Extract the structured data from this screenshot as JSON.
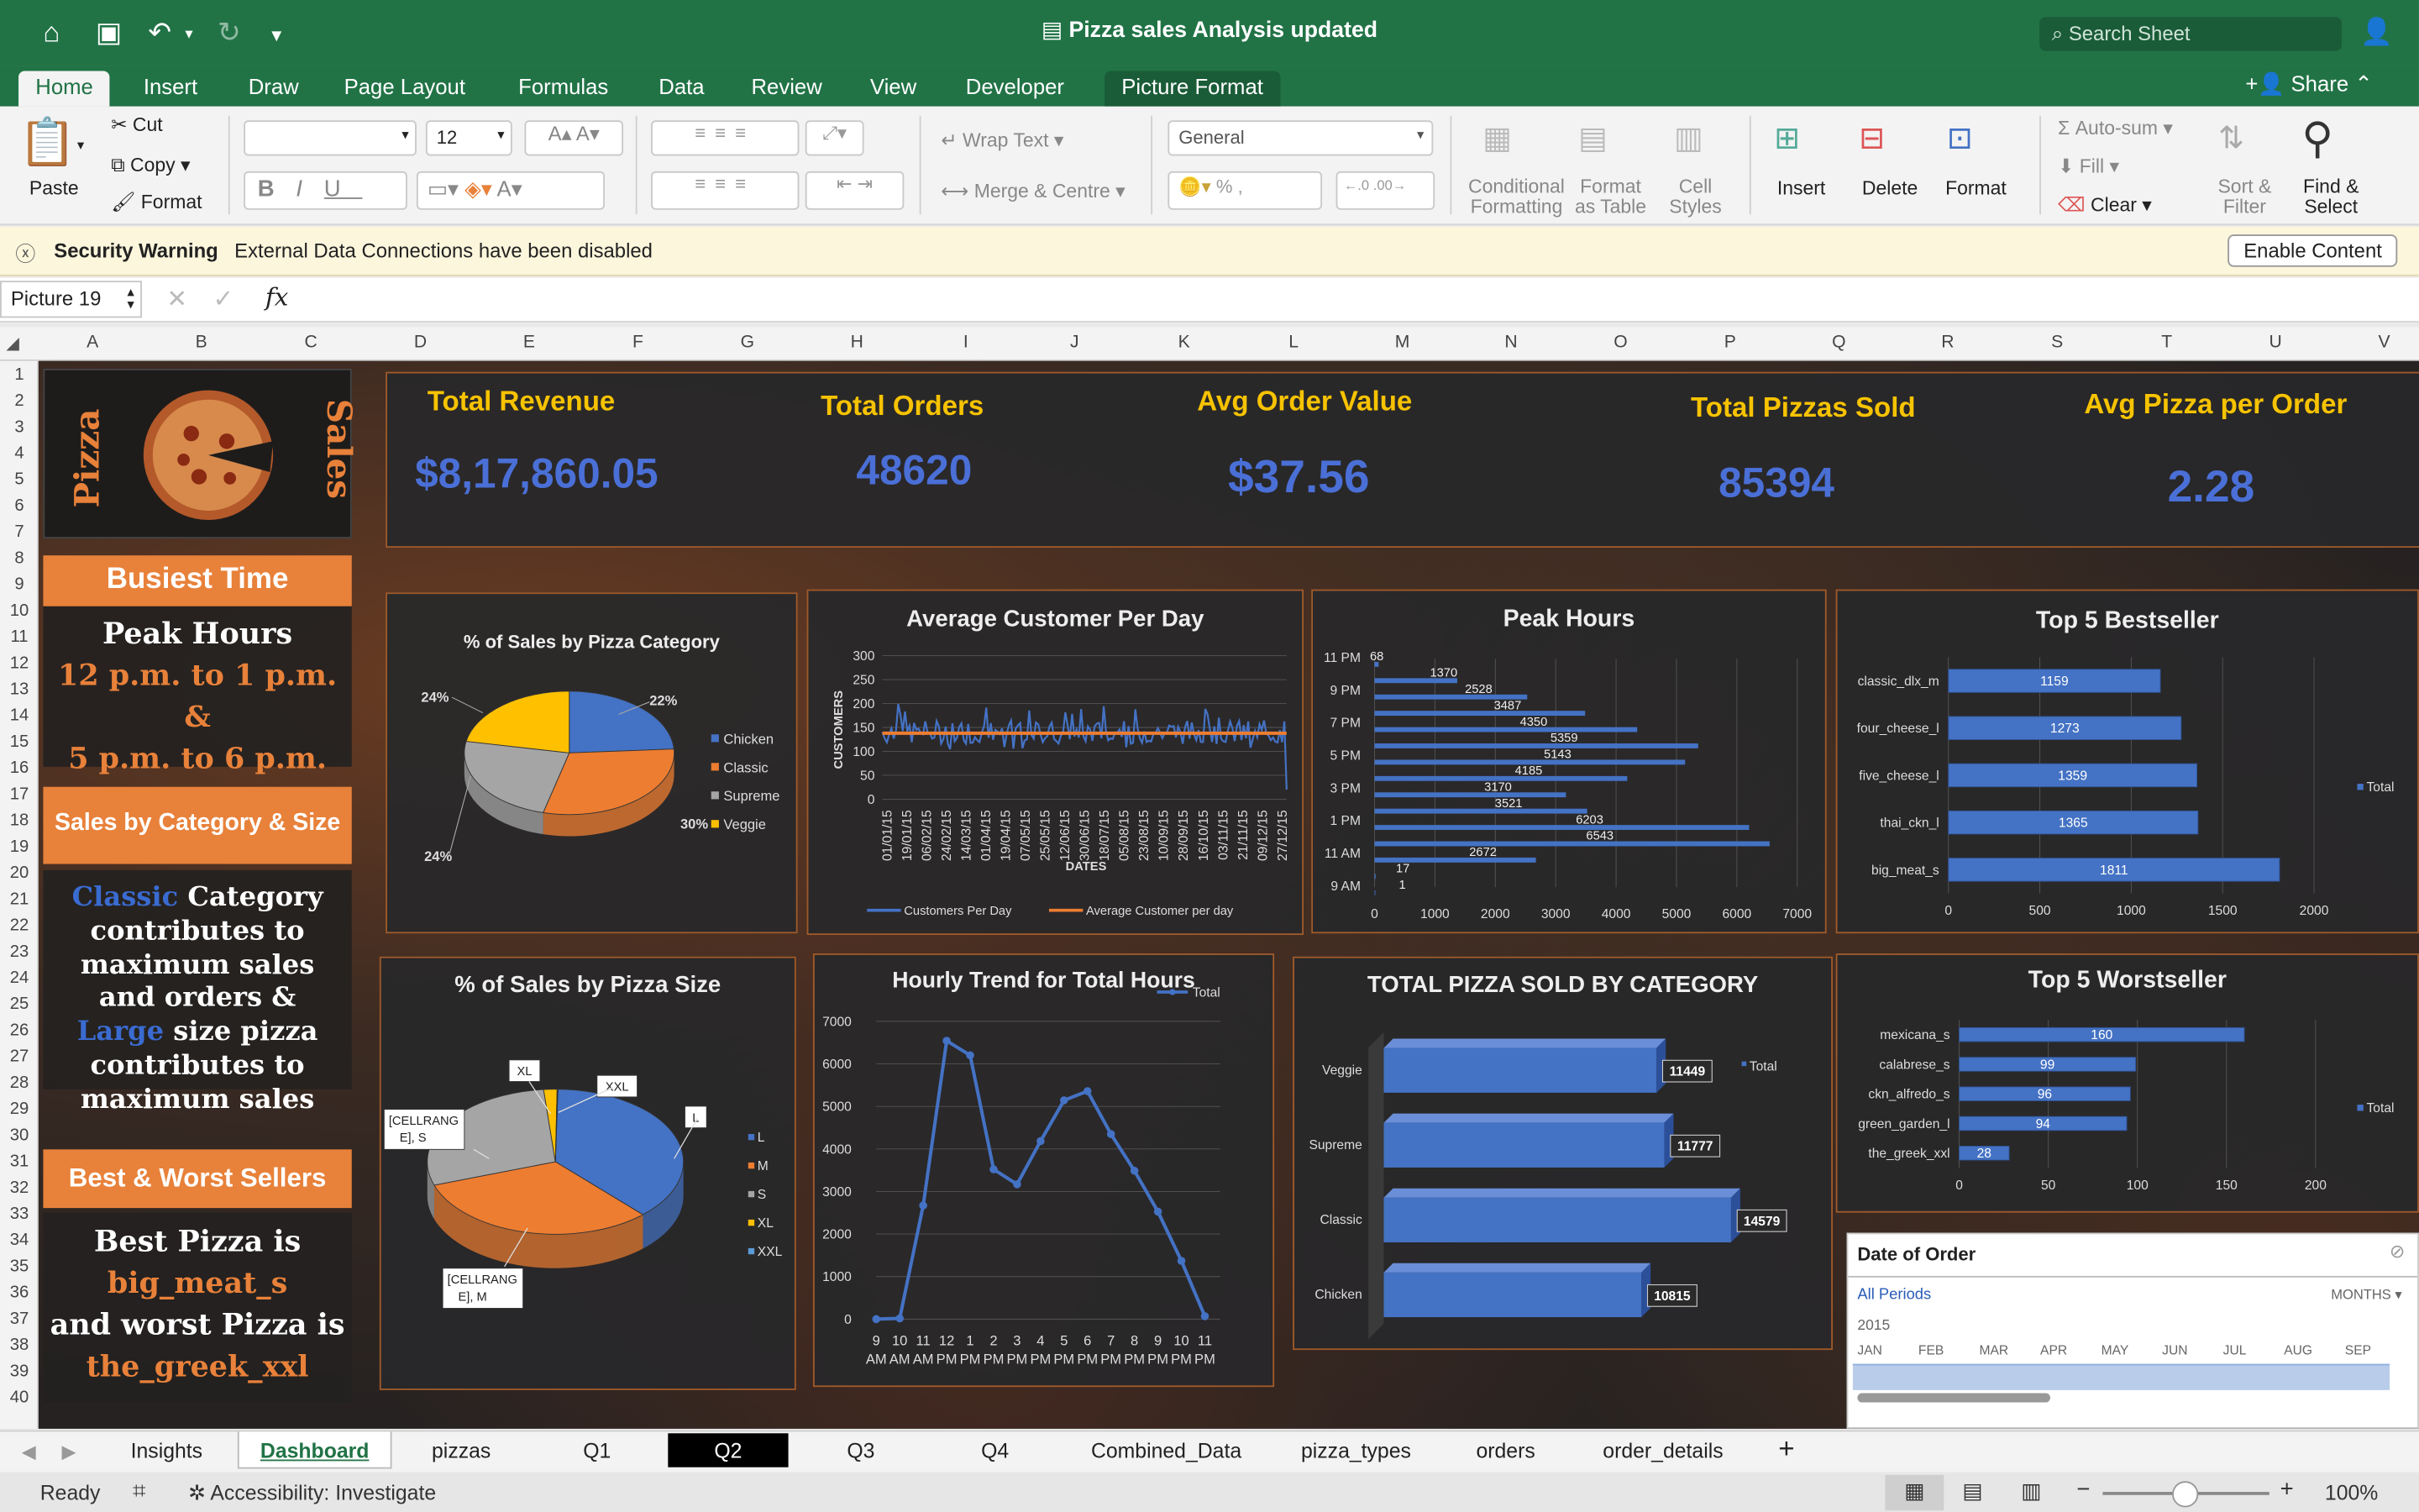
{
  "window": {
    "title": "Pizza sales Analysis updated",
    "search_placeholder": "Search Sheet"
  },
  "ribbon_tabs": [
    "Home",
    "Insert",
    "Draw",
    "Page Layout",
    "Formulas",
    "Data",
    "Review",
    "View",
    "Developer",
    "Picture Format"
  ],
  "share_label": "Share",
  "ribbon": {
    "paste": "Paste",
    "cut": "Cut",
    "copy": "Copy",
    "format_painter": "Format",
    "font_name": "",
    "font_size": "12",
    "wrap_text": "Wrap Text",
    "merge_centre": "Merge & Centre",
    "number_format": "General",
    "conditional_formatting": "Conditional Formatting",
    "format_as_table": "Format as Table",
    "cell_styles": "Cell Styles",
    "insert": "Insert",
    "delete": "Delete",
    "format": "Format",
    "autosum": "Auto-sum",
    "fill": "Fill",
    "clear": "Clear",
    "sort_filter": "Sort & Filter",
    "find_select": "Find & Select"
  },
  "security": {
    "title": "Security Warning",
    "message": "External Data Connections have been disabled",
    "button": "Enable Content"
  },
  "formula_bar": {
    "name_box": "Picture 19",
    "formula": ""
  },
  "columns": [
    "A",
    "B",
    "C",
    "D",
    "E",
    "F",
    "G",
    "H",
    "I",
    "J",
    "K",
    "L",
    "M",
    "N",
    "O",
    "P",
    "Q",
    "R",
    "S",
    "T",
    "U",
    "V"
  ],
  "rows": [
    "1",
    "2",
    "3",
    "4",
    "5",
    "6",
    "7",
    "8",
    "9",
    "10",
    "11",
    "12",
    "13",
    "14",
    "15",
    "16",
    "17",
    "18",
    "19",
    "20",
    "21",
    "22",
    "23",
    "24",
    "25",
    "26",
    "27",
    "28",
    "29",
    "30",
    "31",
    "32",
    "33",
    "34",
    "35",
    "36",
    "37",
    "38",
    "39",
    "40"
  ],
  "logo": {
    "left": "Pizza",
    "right": "Sales"
  },
  "kpis": [
    {
      "label": "Total Revenue",
      "value": "$8,17,860.05"
    },
    {
      "label": "Total Orders",
      "value": "48620"
    },
    {
      "label": "Avg Order Value",
      "value": "$37.56"
    },
    {
      "label": "Total Pizzas Sold",
      "value": "85394"
    },
    {
      "label": "Avg Pizza per Order",
      "value": "2.28"
    }
  ],
  "sidebar": {
    "busiest_title": "Busiest Time",
    "peak_label": "Peak Hours",
    "peak_line1": "12 p.m. to 1 p.m. &",
    "peak_line2": "5 p.m. to 6 p.m.",
    "catsize_title": "Sales by Category & Size",
    "catsize_text": "Classic Category contributes to maximum sales and orders & Large size pizza contributes to maximum sales",
    "bestworst_title": "Best & Worst Sellers",
    "best_label": "Best Pizza is",
    "best_name": "big_meat_s",
    "worst_label": "and worst Pizza is",
    "worst_name": "the_greek_xxl"
  },
  "chart_data": [
    {
      "id": "category-pie",
      "type": "pie",
      "title": "% of Sales by Pizza Category",
      "categories": [
        "Chicken",
        "Classic",
        "Supreme",
        "Veggie"
      ],
      "values": [
        24,
        30,
        24,
        22
      ],
      "labels": [
        "24%",
        "30%",
        "24%",
        "22%"
      ],
      "colors": [
        "#4472c4",
        "#ed7d31",
        "#a5a5a5",
        "#ffc000"
      ],
      "legend": "right"
    },
    {
      "id": "customers-line",
      "type": "line",
      "title": "Average Customer Per Day",
      "xlabel": "DATES",
      "ylabel": "CUSTOMERS",
      "yticks": [
        0,
        50,
        100,
        150,
        200,
        250,
        300
      ],
      "ylim": [
        0,
        300
      ],
      "xticks": [
        "01/01/15",
        "19/01/15",
        "06/02/15",
        "24/02/15",
        "14/03/15",
        "01/04/15",
        "19/04/15",
        "07/05/15",
        "25/05/15",
        "12/06/15",
        "30/06/15",
        "18/07/15",
        "05/08/15",
        "23/08/15",
        "10/09/15",
        "28/09/15",
        "16/10/15",
        "03/11/15",
        "21/11/15",
        "09/12/15",
        "27/12/15"
      ],
      "series": [
        {
          "name": "Customers Per Day",
          "color": "#4472c4",
          "approx_range": [
            95,
            200
          ]
        },
        {
          "name": "Average Customer per day",
          "color": "#ed7d31",
          "value": 138
        }
      ],
      "legend": "bottom"
    },
    {
      "id": "peak-hours",
      "type": "bar",
      "title": "Peak Hours",
      "categories": [
        "11 PM",
        "10 PM",
        "9 PM",
        "8 PM",
        "7 PM",
        "6 PM",
        "5 PM",
        "4 PM",
        "3 PM",
        "2 PM",
        "1 PM",
        "12 PM",
        "11 AM",
        "10 AM",
        "9 AM"
      ],
      "values": [
        68,
        1370,
        2528,
        3487,
        4350,
        5359,
        5143,
        4185,
        3170,
        3521,
        6203,
        6543,
        2672,
        17,
        1
      ],
      "xticks": [
        0,
        1000,
        2000,
        3000,
        4000,
        5000,
        6000,
        7000
      ],
      "xlim": [
        0,
        7000
      ],
      "ytick_labels": [
        "11 PM",
        "9 PM",
        "7 PM",
        "5 PM",
        "3 PM",
        "1 PM",
        "11 AM",
        "9 AM"
      ]
    },
    {
      "id": "top5-best",
      "type": "bar",
      "title": "Top 5 Bestseller",
      "categories": [
        "classic_dlx_m",
        "four_cheese_l",
        "five_cheese_l",
        "thai_ckn_l",
        "big_meat_s"
      ],
      "values": [
        1159,
        1273,
        1359,
        1365,
        1811
      ],
      "xticks": [
        0,
        500,
        1000,
        1500,
        2000
      ],
      "xlim": [
        0,
        2000
      ],
      "legend": "Total"
    },
    {
      "id": "size-pie",
      "type": "pie",
      "title": "% of Sales by Pizza Size",
      "categories": [
        "L",
        "M",
        "S",
        "XL",
        "XXL"
      ],
      "values": [
        38,
        32,
        29,
        1.7,
        0.1
      ],
      "labels": [
        "L",
        "[CELLRANG E], M",
        "[CELLRANG E], S",
        "XL",
        "XXL"
      ],
      "colors": [
        "#4472c4",
        "#ed7d31",
        "#a5a5a5",
        "#ffc000",
        "#5b9bd5"
      ],
      "legend": "right"
    },
    {
      "id": "hourly-trend",
      "type": "line",
      "title": "Hourly Trend for Total Hours",
      "legend": "Total",
      "categories": [
        "9 AM",
        "10 AM",
        "11 AM",
        "12 PM",
        "1 PM",
        "2 PM",
        "3 PM",
        "4 PM",
        "5 PM",
        "6 PM",
        "7 PM",
        "8 PM",
        "9 PM",
        "10 PM",
        "11 PM"
      ],
      "tick_hours": [
        "9",
        "10",
        "11",
        "12",
        "1",
        "2",
        "3",
        "4",
        "5",
        "6",
        "7",
        "8",
        "9",
        "10",
        "11"
      ],
      "tick_ampm": [
        "AM",
        "AM",
        "AM",
        "PM",
        "PM",
        "PM",
        "PM",
        "PM",
        "PM",
        "PM",
        "PM",
        "PM",
        "PM",
        "PM",
        "PM"
      ],
      "values": [
        1,
        17,
        2672,
        6543,
        6203,
        3521,
        3170,
        4185,
        5143,
        5359,
        4350,
        3487,
        2528,
        1370,
        68
      ],
      "yticks": [
        0,
        1000,
        2000,
        3000,
        4000,
        5000,
        6000,
        7000
      ],
      "ylim": [
        0,
        7000
      ]
    },
    {
      "id": "sold-by-category",
      "type": "bar",
      "title": "TOTAL PIZZA SOLD BY CATEGORY",
      "legend": "Total",
      "categories": [
        "Veggie",
        "Supreme",
        "Classic",
        "Chicken"
      ],
      "values": [
        11449,
        11777,
        14579,
        10815
      ]
    },
    {
      "id": "top5-worst",
      "type": "bar",
      "title": "Top 5 Worstseller",
      "categories": [
        "mexicana_s",
        "calabrese_s",
        "ckn_alfredo_s",
        "green_garden_l",
        "the_greek_xxl"
      ],
      "values": [
        160,
        99,
        96,
        94,
        28
      ],
      "xticks": [
        0,
        50,
        100,
        150,
        200
      ],
      "xlim": [
        0,
        200
      ],
      "legend": "Total"
    }
  ],
  "slicer": {
    "title": "Date of Order",
    "period": "All Periods",
    "granularity": "MONTHS",
    "year": "2015",
    "months": [
      "JAN",
      "FEB",
      "MAR",
      "APR",
      "MAY",
      "JUN",
      "JUL",
      "AUG",
      "SEP"
    ]
  },
  "sheet_tabs": [
    "Insights",
    "Dashboard",
    "pizzas",
    "Q1",
    "Q2",
    "Q3",
    "Q4",
    "Combined_Data",
    "pizza_types",
    "orders",
    "order_details"
  ],
  "status": {
    "ready": "Ready",
    "accessibility": "Accessibility: Investigate",
    "zoom": "100%"
  },
  "colors": {
    "excel_green": "#217346",
    "accent_orange": "#e8813a",
    "kpi_yellow": "#f7c300",
    "kpi_blue": "#4a6fd6",
    "bar_blue": "#4472c4",
    "line_orange": "#ed7d31"
  }
}
